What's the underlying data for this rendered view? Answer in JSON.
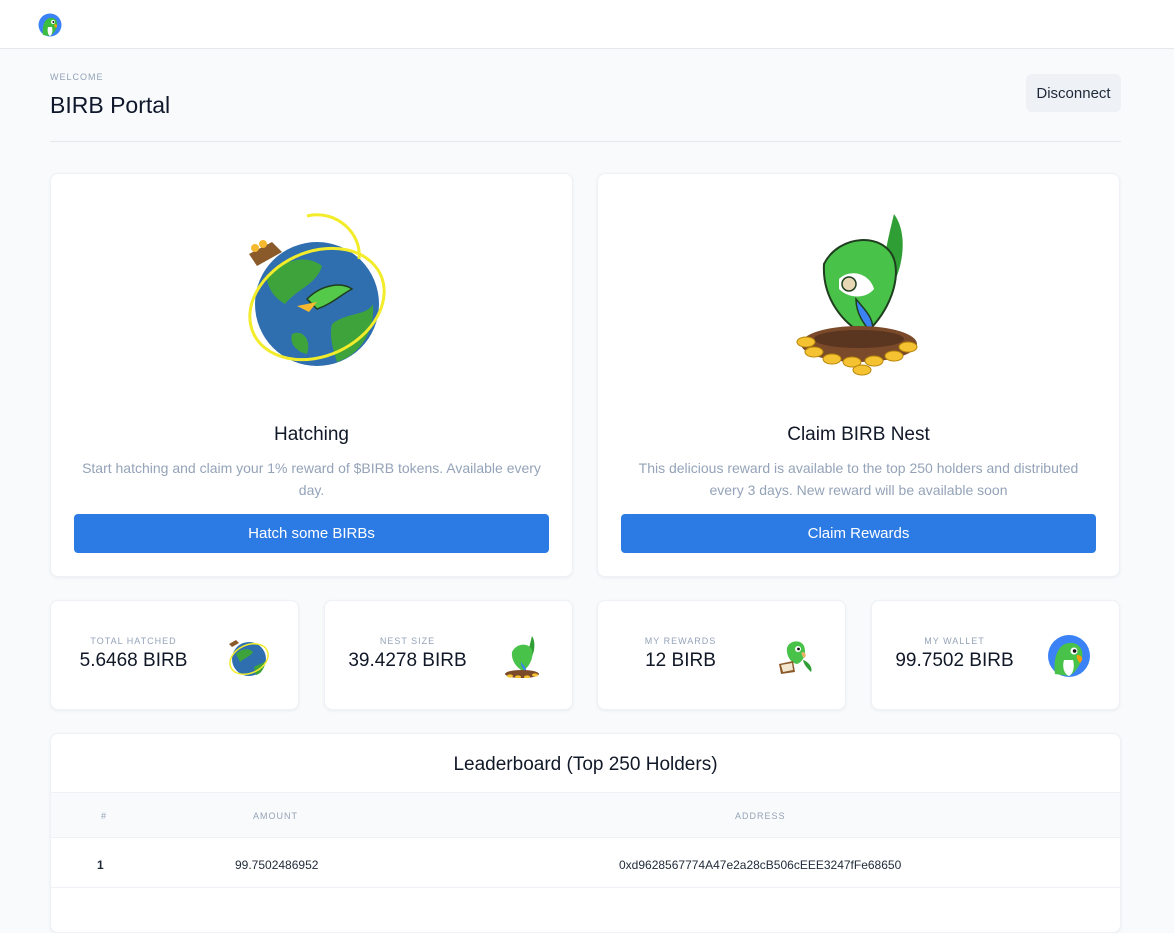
{
  "header": {
    "eyebrow": "WELCOME",
    "title": "BIRB Portal",
    "disconnect_label": "Disconnect"
  },
  "cards": [
    {
      "title": "Hatching",
      "description": "Start hatching and claim your 1% reward of $BIRB tokens. Available every day.",
      "button_label": "Hatch some BIRBs",
      "icon": "globe-parrot-icon"
    },
    {
      "title": "Claim BIRB Nest",
      "description": "This delicious reward is available to the top 250 holders and distributed every 3 days. New reward will be available soon",
      "button_label": "Claim Rewards",
      "icon": "parrot-nest-icon"
    }
  ],
  "stats": [
    {
      "label": "TOTAL HATCHED",
      "value": "5.6468 BIRB",
      "icon": "globe-parrot-icon"
    },
    {
      "label": "NEST SIZE",
      "value": "39.4278 BIRB",
      "icon": "parrot-nest-icon"
    },
    {
      "label": "MY REWARDS",
      "value": "12 BIRB",
      "icon": "parrot-reader-icon"
    },
    {
      "label": "MY WALLET",
      "value": "99.7502 BIRB",
      "icon": "parrot-avatar-icon"
    }
  ],
  "leaderboard": {
    "title": "Leaderboard (Top 250 Holders)",
    "columns": [
      "#",
      "AMOUNT",
      "ADDRESS"
    ],
    "rows": [
      {
        "rank": "1",
        "amount": "99.7502486952",
        "address": "0xd9628567774A47e2a28cB506cEEE3247fFe68650"
      }
    ]
  },
  "colors": {
    "primary": "#2c7be5",
    "background": "#f8fafc",
    "muted_text": "#94a3b8"
  }
}
